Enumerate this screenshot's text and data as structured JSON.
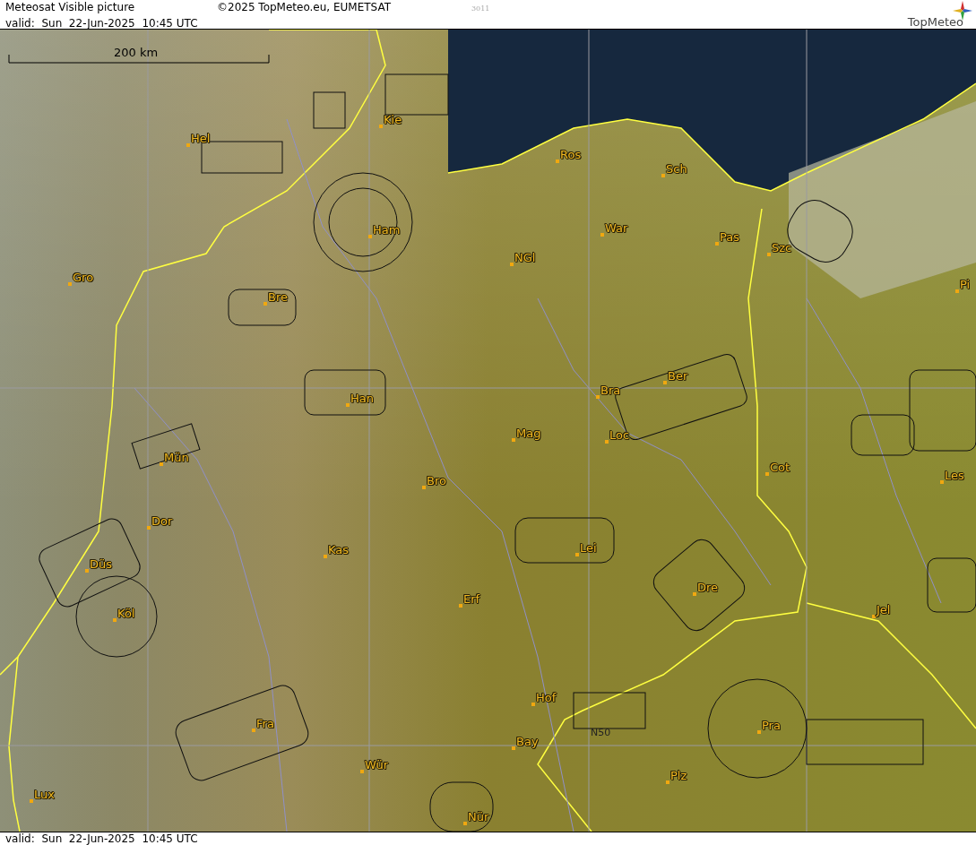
{
  "header": {
    "title": "Meteosat Visible picture",
    "copyright": "©2025 TopMeteo.eu, EUMETSAT",
    "code": "3011",
    "valid": "valid:  Sun  22-Jun-2025  10:45 UTC",
    "logo": "TopMeteo"
  },
  "map": {
    "scale": "200 km",
    "labels": [
      {
        "text": "Kie",
        "kind": "city"
      },
      {
        "text": "Hel",
        "kind": "city"
      },
      {
        "text": "Ros",
        "kind": "city"
      },
      {
        "text": "Sch",
        "kind": "city"
      },
      {
        "text": "Ham",
        "kind": "city"
      },
      {
        "text": "War",
        "kind": "city"
      },
      {
        "text": "Pas",
        "kind": "city"
      },
      {
        "text": "Szc",
        "kind": "city"
      },
      {
        "text": "NGl",
        "kind": "city"
      },
      {
        "text": "Gro",
        "kind": "city"
      },
      {
        "text": "Bre",
        "kind": "city"
      },
      {
        "text": "Pi",
        "kind": "city"
      },
      {
        "text": "Ber",
        "kind": "city"
      },
      {
        "text": "Bra",
        "kind": "city"
      },
      {
        "text": "Han",
        "kind": "city"
      },
      {
        "text": "Mag",
        "kind": "city"
      },
      {
        "text": "Loc",
        "kind": "city"
      },
      {
        "text": "Mün",
        "kind": "city"
      },
      {
        "text": "Cot",
        "kind": "city"
      },
      {
        "text": "Les",
        "kind": "city"
      },
      {
        "text": "Bro",
        "kind": "city"
      },
      {
        "text": "Dor",
        "kind": "city"
      },
      {
        "text": "Kas",
        "kind": "city"
      },
      {
        "text": "Lei",
        "kind": "city"
      },
      {
        "text": "Düs",
        "kind": "city"
      },
      {
        "text": "Dre",
        "kind": "city"
      },
      {
        "text": "Erf",
        "kind": "city"
      },
      {
        "text": "Jel",
        "kind": "city"
      },
      {
        "text": "Köl",
        "kind": "city"
      },
      {
        "text": "Hof",
        "kind": "city"
      },
      {
        "text": "Fra",
        "kind": "city"
      },
      {
        "text": "Pra",
        "kind": "city"
      },
      {
        "text": "N50",
        "kind": "grid"
      },
      {
        "text": "Bay",
        "kind": "city"
      },
      {
        "text": "Wür",
        "kind": "city"
      },
      {
        "text": "Plz",
        "kind": "city"
      },
      {
        "text": "Lux",
        "kind": "city"
      },
      {
        "text": "Nür",
        "kind": "city"
      }
    ]
  },
  "footer": {
    "valid": "valid:  Sun  22-Jun-2025  10:45 UTC"
  }
}
